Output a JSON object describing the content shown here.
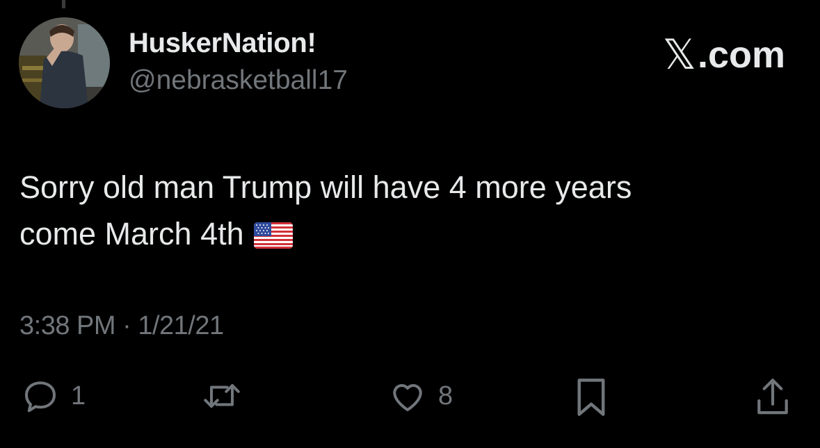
{
  "user": {
    "display_name": "HuskerNation!",
    "handle": "@nebrasketball17"
  },
  "brand": {
    "x_glyph": "𝕏",
    "suffix": ".com"
  },
  "tweet": {
    "line1": "Sorry old man Trump will have 4 more years",
    "line2": "come March 4th",
    "emoji": "us-flag-emoji"
  },
  "meta": {
    "time": "3:38 PM",
    "separator": " · ",
    "date": "1/21/21"
  },
  "actions": {
    "replies": "1",
    "reposts": "",
    "likes": "8"
  },
  "colors": {
    "background": "#000000",
    "text": "#e7e9ea",
    "muted": "#71767b"
  },
  "icons": [
    "reply-icon",
    "repost-icon",
    "like-icon",
    "bookmark-icon",
    "share-icon"
  ]
}
